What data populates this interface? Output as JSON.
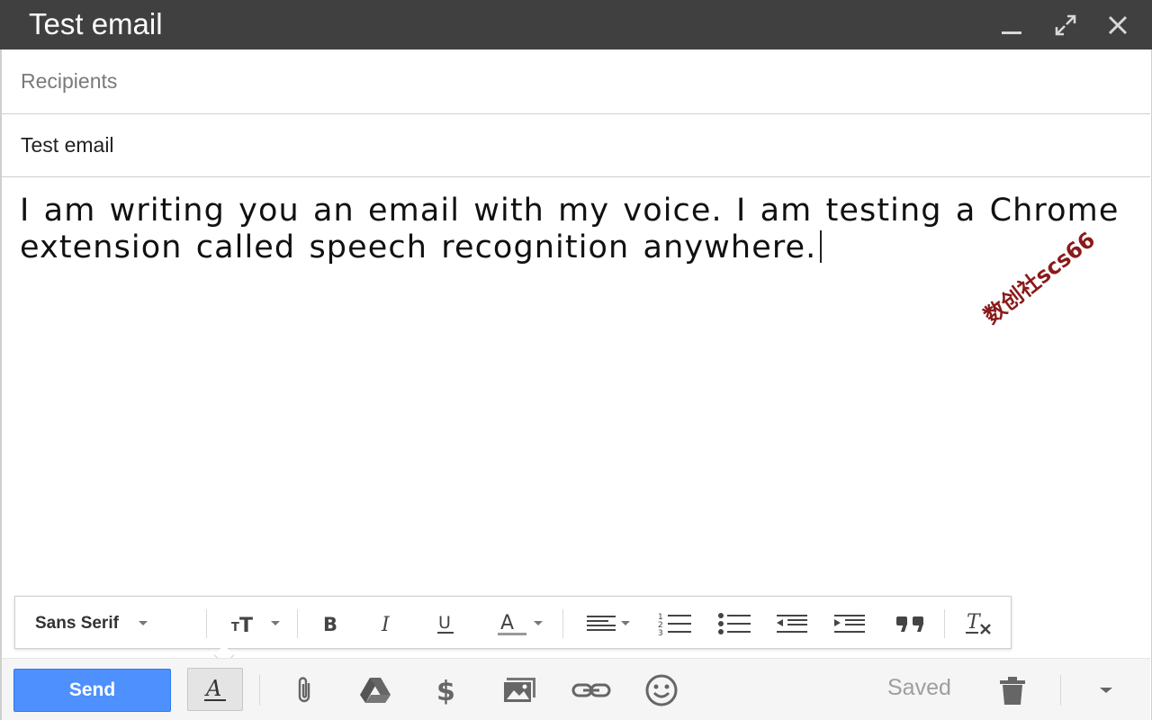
{
  "window": {
    "title": "Test email"
  },
  "compose": {
    "recipients_placeholder": "Recipients",
    "subject_value": "Test email",
    "body_text": "I am writing you an email with my voice. I am testing a Chrome extension called speech recognition anywhere."
  },
  "watermark": "数创社scs66",
  "format_toolbar": {
    "font_family": "Sans Serif",
    "items": [
      "font-size",
      "bold",
      "italic",
      "underline",
      "text-color",
      "align",
      "numbered-list",
      "bulleted-list",
      "indent-less",
      "indent-more",
      "quote",
      "remove-formatting"
    ]
  },
  "bottom_bar": {
    "send_label": "Send",
    "status": "Saved",
    "icons": [
      "formatting-options-icon",
      "attach-icon",
      "drive-icon",
      "money-icon",
      "photo-icon",
      "link-icon",
      "emoji-icon",
      "trash-icon",
      "more-options-icon"
    ]
  },
  "colors": {
    "titlebar_bg": "#404040",
    "send_button": "#4d90fe",
    "watermark": "#8b1a1a"
  }
}
